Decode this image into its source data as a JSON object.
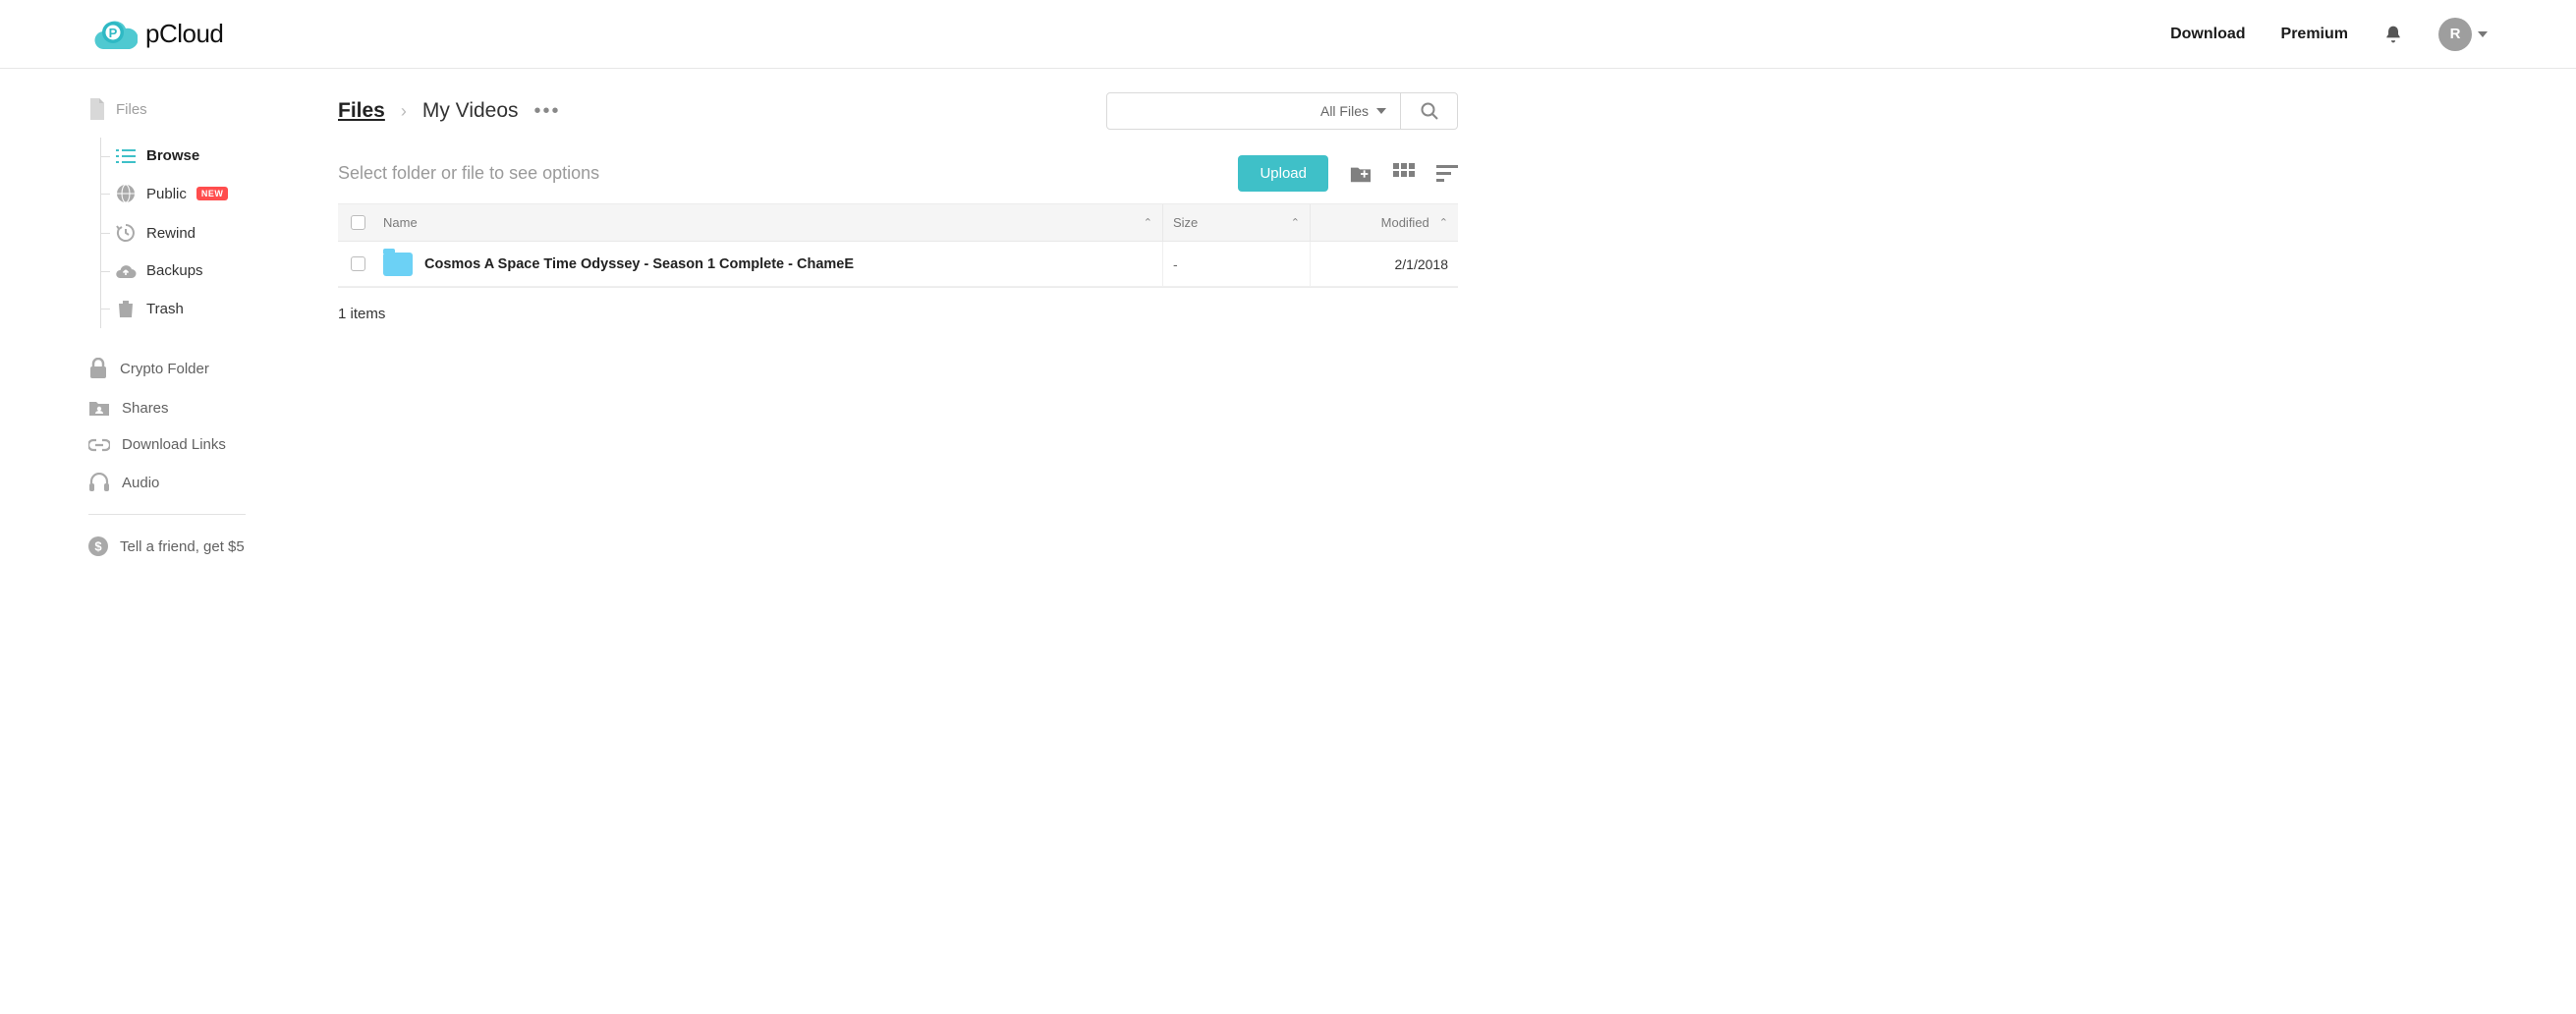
{
  "brand": {
    "name": "pCloud"
  },
  "header": {
    "download": "Download",
    "premium": "Premium",
    "avatar_initial": "R"
  },
  "sidebar": {
    "root": "Files",
    "items": [
      {
        "label": "Browse",
        "icon": "list",
        "active": true
      },
      {
        "label": "Public",
        "icon": "globe",
        "badge": "NEW"
      },
      {
        "label": "Rewind",
        "icon": "history"
      },
      {
        "label": "Backups",
        "icon": "cloud-up"
      },
      {
        "label": "Trash",
        "icon": "trash"
      }
    ],
    "main": [
      {
        "label": "Crypto Folder",
        "icon": "lock"
      },
      {
        "label": "Shares",
        "icon": "shared-folder"
      },
      {
        "label": "Download Links",
        "icon": "link"
      },
      {
        "label": "Audio",
        "icon": "headphones"
      }
    ],
    "referral": "Tell a friend, get $5"
  },
  "breadcrumb": {
    "root": "Files",
    "current": "My Videos"
  },
  "search": {
    "filter_label": "All Files"
  },
  "toolbar": {
    "placeholder": "Select folder or file to see options",
    "upload": "Upload"
  },
  "table": {
    "columns": {
      "name": "Name",
      "size": "Size",
      "modified": "Modified"
    },
    "rows": [
      {
        "name": "Cosmos A Space Time Odyssey - Season 1 Complete - ChameE",
        "size": "-",
        "modified": "2/1/2018"
      }
    ],
    "footer": "1 items"
  }
}
